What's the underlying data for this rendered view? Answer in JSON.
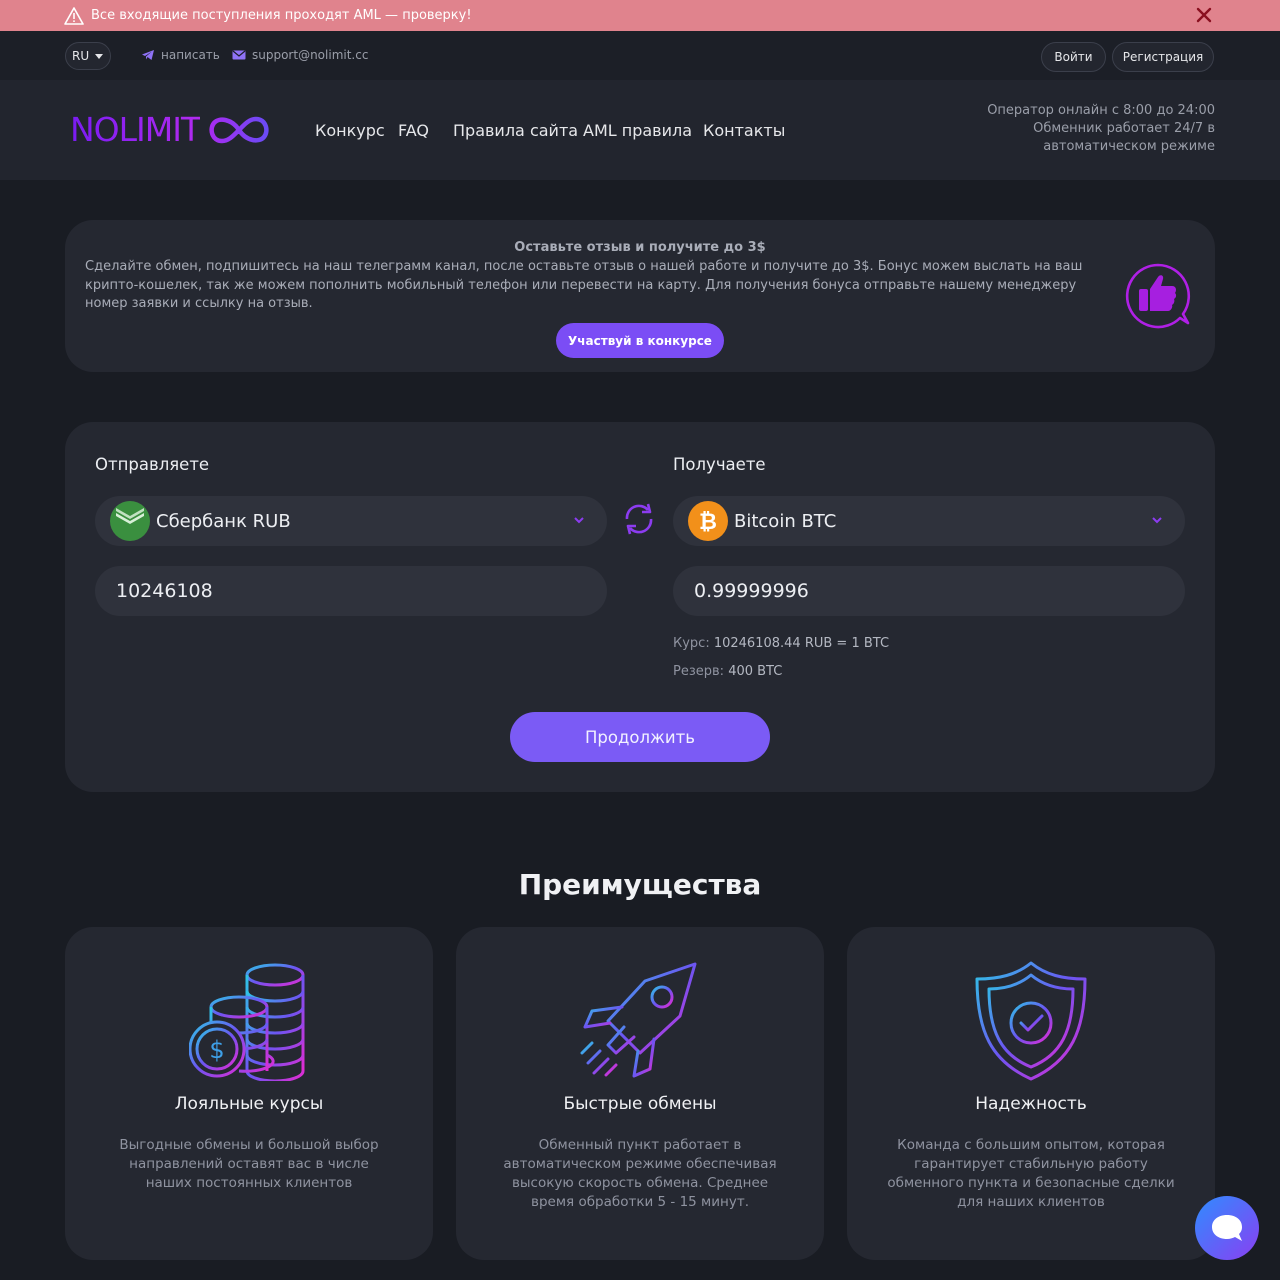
{
  "alert": {
    "text": "Все входящие поступления проходят AML — проверку!"
  },
  "topbar": {
    "lang": "RU",
    "write_label": "написать",
    "email": "support@nolimit.cc",
    "login_label": "Войти",
    "register_label": "Регистрация"
  },
  "header": {
    "logo_text": "NOLIMIT",
    "nav": [
      "Конкурс",
      "FAQ",
      "Правила сайта",
      "AML правила",
      "Контакты"
    ],
    "operator_text": "Оператор онлайн с 8:00 до 24:00 Обменник работает 24/7 в автоматическом режиме"
  },
  "review": {
    "title": "Оставьте отзыв и получите до 3$",
    "text": "Сделайте обмен, подпишитесь на наш телеграмм канал, после оставьте отзыв о нашей работе и получите до 3$. Бонус можем выслать на ваш крипто-кошелек, так же можем пополнить мобильный телефон или перевести на карту. Для получения бонуса отправьте нашему менеджеру номер заявки и ссылку на отзыв.",
    "button_label": "Участвуй в конкурсе"
  },
  "exchange": {
    "send_label": "Отправляете",
    "receive_label": "Получаете",
    "send_currency": "Сбербанк RUB",
    "receive_currency": "Bitcoin BTC",
    "send_amount": "10246108",
    "receive_amount": "0.99999996",
    "rate_label": "Курс:",
    "rate_value": "10246108.44 RUB = 1 BTC",
    "reserve_label": "Резерв:",
    "reserve_value": "400 BTC",
    "continue_label": "Продолжить"
  },
  "advantages": {
    "title": "Преимущества",
    "items": [
      {
        "title": "Лояльные курсы",
        "text": "Выгодные обмены и большой выбор направлений оставят вас в числе наших постоянных клиентов",
        "icon": "coins-icon"
      },
      {
        "title": "Быстрые обмены",
        "text": "Обменный пункт работает в автоматическом режиме обеспечивая высокую скорость обмена. Среднее время обработки 5 - 15 минут.",
        "icon": "rocket-icon"
      },
      {
        "title": "Надежность",
        "text": "Команда с большим опытом, которая гарантирует стабильную работу обменного пункта и безопасные сделки для наших клиентов",
        "icon": "shield-icon"
      }
    ]
  },
  "colors": {
    "accent": "#7b5bf5",
    "alert_bg": "#e0838d",
    "background": "#191c23",
    "card": "#252831"
  }
}
